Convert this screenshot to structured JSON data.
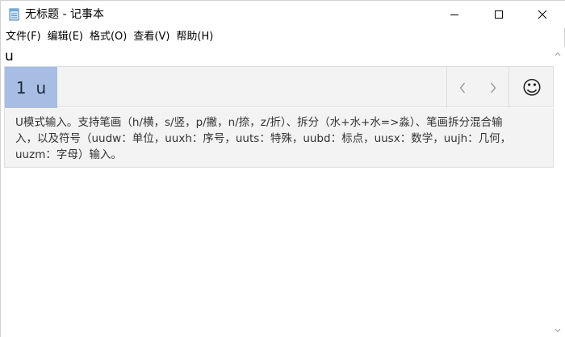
{
  "window": {
    "title": "无标题 - 记事本"
  },
  "menu": {
    "items": [
      {
        "label": "文件(F)"
      },
      {
        "label": "编辑(E)"
      },
      {
        "label": "格式(O)"
      },
      {
        "label": "查看(V)"
      },
      {
        "label": "帮助(H)"
      }
    ]
  },
  "editor": {
    "text": "u"
  },
  "ime": {
    "candidate_index": "1",
    "candidate_text": "u",
    "emoji_symbol": "☺",
    "hint_lines": [
      "U模式输入。支持笔画（h/横，s/竖，p/撇，n/捺，z/折）、拆分（水+水+水=>淼）、笔画拆分混合输",
      "入，以及符号（uudw：单位，uuxh：序号，uuts：特殊，uubd：标点，uusx：数学，uujh：几何，",
      "uuzm：字母）输入。"
    ],
    "selected_color": "#a7bde3"
  },
  "icons": {
    "app": "notepad-icon",
    "minimize": "minimize-icon",
    "maximize": "maximize-icon",
    "close": "close-icon",
    "prev": "chevron-left-icon",
    "next": "chevron-right-icon",
    "emoji": "smiley-icon",
    "scroll_up": "scroll-up-arrow-icon",
    "scroll_down": "scroll-down-arrow-icon"
  }
}
